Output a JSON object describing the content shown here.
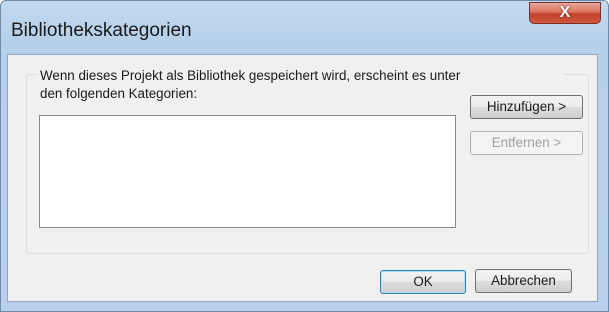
{
  "window": {
    "title": "Bibliothekskategorien",
    "close_symbol": "X"
  },
  "group": {
    "description_line1": "Wenn dieses Projekt als Bibliothek gespeichert wird, erscheint es unter",
    "description_line2": "den folgenden Kategorien:"
  },
  "categories_list": {
    "items": []
  },
  "buttons": {
    "add_label": "Hinzufügen >",
    "remove_label": "Entfernen >",
    "remove_enabled": false,
    "ok_label": "OK",
    "cancel_label": "Abbrechen"
  },
  "colors": {
    "titlebar": "#b9d1ea",
    "close_button": "#c94a33",
    "dialog_background": "#f0f0f0",
    "default_button_border": "#3c7fb1"
  },
  "icons": {
    "close": "close-icon"
  }
}
